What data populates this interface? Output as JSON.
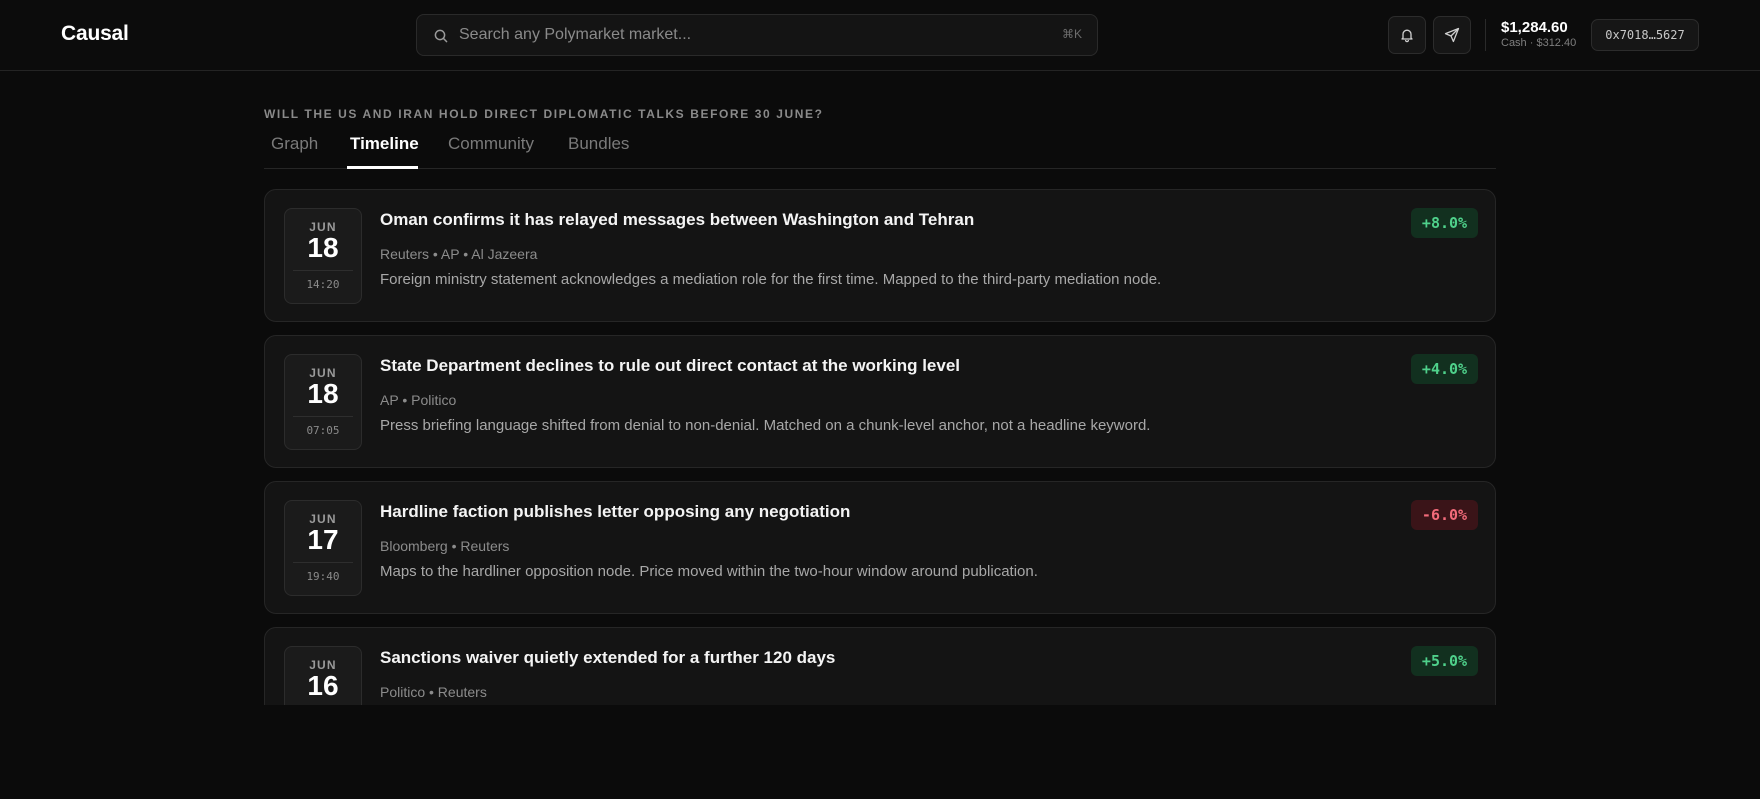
{
  "app": {
    "brand": "Causal"
  },
  "search": {
    "placeholder": "Search any Polymarket market...",
    "shortcut": "⌘K",
    "icon": "search-icon"
  },
  "header_actions": {
    "notifications_icon": "bell-icon",
    "send_icon": "send-icon"
  },
  "account": {
    "balance": "$1,284.60",
    "cash_label": "Cash · $312.40",
    "wallet": "0x7018…5627"
  },
  "market": {
    "question": "WILL THE US AND IRAN HOLD DIRECT DIPLOMATIC TALKS BEFORE 30 JUNE?"
  },
  "tabs": [
    {
      "label": "Graph",
      "active": false
    },
    {
      "label": "Timeline",
      "active": true
    },
    {
      "label": "Community",
      "active": false
    },
    {
      "label": "Bundles",
      "active": false
    }
  ],
  "events": [
    {
      "month": "JUN",
      "day": "18",
      "time": "14:20",
      "headline": "Oman confirms it has relayed messages between Washington and Tehran",
      "sources": "Reuters • AP • Al Jazeera",
      "summary": "Foreign ministry statement acknowledges a mediation role for the first time. Mapped to the third-party mediation node.",
      "delta": "+8.0%",
      "direction": "positive"
    },
    {
      "month": "JUN",
      "day": "18",
      "time": "07:05",
      "headline": "State Department declines to rule out direct contact at the working level",
      "sources": "AP • Politico",
      "summary": "Press briefing language shifted from denial to non-denial. Matched on a chunk-level anchor, not a headline keyword.",
      "delta": "+4.0%",
      "direction": "positive"
    },
    {
      "month": "JUN",
      "day": "17",
      "time": "19:40",
      "headline": "Hardline faction publishes letter opposing any negotiation",
      "sources": "Bloomberg • Reuters",
      "summary": "Maps to the hardliner opposition node. Price moved within the two-hour window around publication.",
      "delta": "-6.0%",
      "direction": "negative"
    },
    {
      "month": "JUN",
      "day": "16",
      "time": "",
      "headline": "Sanctions waiver quietly extended for a further 120 days",
      "sources": "Politico • Reuters",
      "summary": "",
      "delta": "+5.0%",
      "direction": "positive"
    }
  ],
  "colors": {
    "background": "#0b0b0b",
    "card": "#141414",
    "positive": "#4fd18b",
    "negative": "#f26b7a"
  }
}
